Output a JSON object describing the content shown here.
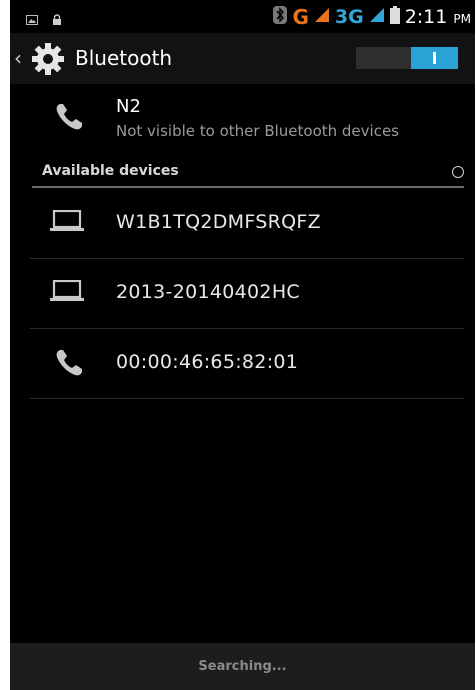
{
  "status_bar": {
    "icons_left": [
      "image-icon",
      "lock-icon"
    ],
    "icons_right": [
      "bluetooth-icon",
      "signal-icon",
      "signal-icon",
      "battery-icon"
    ],
    "network_g": "G",
    "network_3g": "3G",
    "time": "2:11",
    "ampm": "PM"
  },
  "header": {
    "title": "Bluetooth",
    "toggle_on": true,
    "accent_color": "#29a3d6"
  },
  "my_device": {
    "name": "N2",
    "visibility": "Not visible to other Bluetooth devices",
    "icon": "phone-icon"
  },
  "available": {
    "header": "Available devices",
    "devices": [
      {
        "label": "W1B1TQ2DMFSRQFZ",
        "icon": "laptop-icon"
      },
      {
        "label": "2013-20140402HC",
        "icon": "laptop-icon"
      },
      {
        "label": "00:00:46:65:82:01",
        "icon": "phone-icon"
      }
    ]
  },
  "footer": {
    "status": "Searching..."
  }
}
